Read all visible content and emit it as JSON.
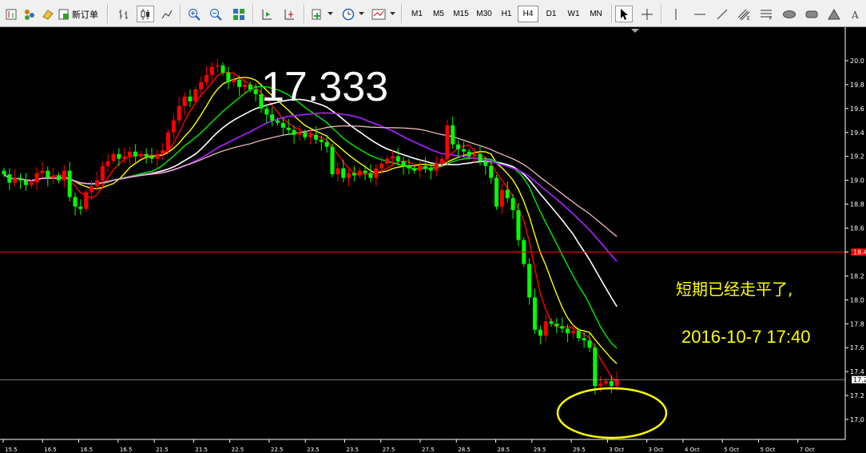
{
  "toolbar": {
    "new_order_label": "新订单",
    "timeframes": [
      "M1",
      "M5",
      "M15",
      "M30",
      "H1",
      "H4",
      "D1",
      "W1",
      "MN"
    ],
    "active_timeframe": "H4"
  },
  "chart": {
    "price_display": "17.333",
    "annotation_line1": "短期已经走平了,",
    "annotation_line2": "2016-10-7 17:40",
    "current_price_tag": "17.2",
    "hline_tag": "18.4",
    "colors": {
      "up": "#ff0000",
      "down": "#00ff00",
      "ma_fast": "#ff0000",
      "ma_yellow": "#ffff00",
      "ma_green": "#00e000",
      "ma_white": "#ffffff",
      "ma_purple": "#a020f0",
      "ma_slow": "#ffc8c8",
      "annotation": "#ffff00",
      "hline": "#ff0000"
    }
  },
  "chart_data": {
    "type": "candlestick",
    "ylim": [
      17.0,
      20.1
    ],
    "y_ticks": [
      "20.0",
      "19.8",
      "19.6",
      "19.4",
      "19.2",
      "19.0",
      "18.8",
      "18.6",
      "18.4",
      "18.2",
      "18.0",
      "17.8",
      "17.6",
      "17.4",
      "17.2",
      "17.0"
    ],
    "x_labels": [
      "15.5",
      "16.5",
      "16.5",
      "16.5",
      "21.5",
      "21.5",
      "22.5",
      "22.5",
      "23.5",
      "23.5",
      "27.5",
      "27.5",
      "28.5",
      "28.5",
      "29.5",
      "29.5",
      "3 Oct",
      "3 Oct",
      "4 Oct",
      "5 Oct",
      "5 Oct",
      "7 Oct"
    ],
    "closes": [
      19.05,
      18.98,
      19.02,
      19.0,
      18.96,
      18.98,
      19.06,
      19.08,
      19.02,
      19.04,
      19.0,
      19.08,
      18.86,
      18.78,
      18.76,
      18.9,
      18.95,
      19.0,
      19.12,
      19.16,
      19.22,
      19.18,
      19.2,
      19.24,
      19.2,
      19.22,
      19.2,
      19.18,
      19.22,
      19.25,
      19.4,
      19.5,
      19.62,
      19.7,
      19.66,
      19.76,
      19.82,
      19.88,
      19.95,
      19.96,
      19.9,
      19.82,
      19.84,
      19.78,
      19.8,
      19.76,
      19.72,
      19.6,
      19.55,
      19.5,
      19.48,
      19.44,
      19.42,
      19.38,
      19.4,
      19.36,
      19.38,
      19.34,
      19.32,
      19.28,
      19.05,
      19.1,
      19.02,
      19.06,
      19.04,
      19.08,
      19.06,
      19.02,
      19.1,
      19.14,
      19.18,
      19.2,
      19.16,
      19.12,
      19.1,
      19.08,
      19.12,
      19.1,
      19.08,
      19.14,
      19.18,
      19.46,
      19.3,
      19.26,
      19.24,
      19.2,
      19.22,
      19.16,
      19.12,
      19.02,
      18.78,
      18.92,
      18.85,
      18.75,
      18.5,
      18.3,
      18.02,
      17.75,
      17.7,
      17.82,
      17.8,
      17.78,
      17.76,
      17.72,
      17.74,
      17.68,
      17.66,
      17.6,
      17.28,
      17.3,
      17.32,
      17.28,
      17.33
    ]
  }
}
